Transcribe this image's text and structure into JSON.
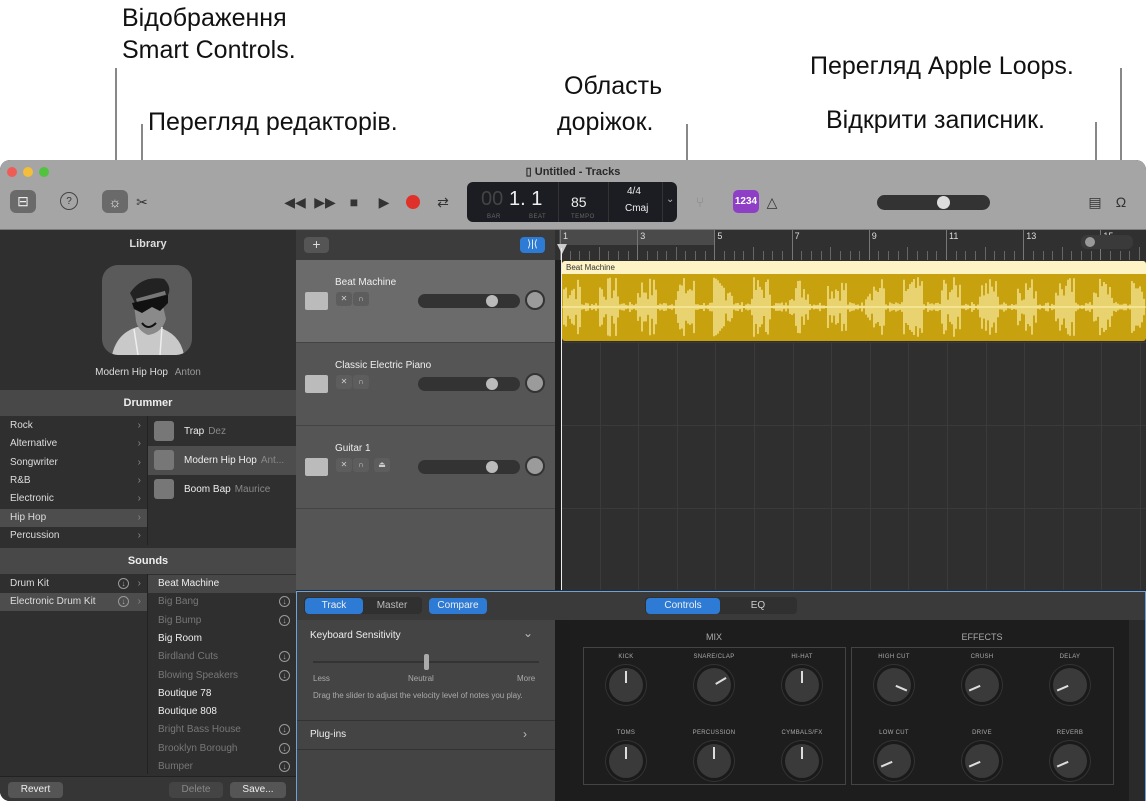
{
  "callouts": {
    "smart_controls_line1": "Відображення",
    "smart_controls_line2": "Smart Controls.",
    "editors": "Перегляд редакторів.",
    "tracks_area_line1": "Область",
    "tracks_area_line2": "доріжок.",
    "apple_loops": "Перегляд Apple Loops.",
    "notepad": "Відкрити записник."
  },
  "window": {
    "title": "Untitled - Tracks"
  },
  "toolbar": {
    "library_icon": "library-icon",
    "help_icon": "help-icon",
    "smart_controls_icon": "smart-controls-icon",
    "editors_icon": "scissors-icon",
    "transport": [
      "rewind-icon",
      "fast-forward-icon",
      "stop-icon",
      "play-icon",
      "record-icon",
      "cycle-icon"
    ],
    "lcd": {
      "bar_dim": "00",
      "position": "1. 1",
      "bar_label": "BAR",
      "beat_label": "BEAT",
      "tempo": "85",
      "tempo_label": "TEMPO",
      "signature": "4/4",
      "key": "Cmaj"
    },
    "count_in": "1234",
    "master_volume": 0.6,
    "record_color": "#e0302a",
    "count_in_color": "#8e3fc6"
  },
  "library": {
    "title": "Library",
    "selected_drummer": "Modern Hip Hop",
    "selected_drummer_name": "Anton",
    "drummer_header": "Drummer",
    "genres": [
      {
        "label": "Rock"
      },
      {
        "label": "Alternative"
      },
      {
        "label": "Songwriter"
      },
      {
        "label": "R&B"
      },
      {
        "label": "Electronic"
      },
      {
        "label": "Hip Hop"
      },
      {
        "label": "Percussion"
      }
    ],
    "drummers": [
      {
        "style": "Trap",
        "name": "Dez"
      },
      {
        "style": "Modern Hip Hop",
        "name": "Ant..."
      },
      {
        "style": "Boom Bap",
        "name": "Maurice"
      }
    ],
    "sounds_header": "Sounds",
    "sound_categories": [
      {
        "label": "Drum Kit"
      },
      {
        "label": "Electronic Drum Kit"
      }
    ],
    "sounds": [
      {
        "label": "Beat Machine"
      },
      {
        "label": "Big Bang"
      },
      {
        "label": "Big Bump"
      },
      {
        "label": "Big Room"
      },
      {
        "label": "Birdland Cuts"
      },
      {
        "label": "Blowing Speakers"
      },
      {
        "label": "Boutique 78"
      },
      {
        "label": "Boutique 808"
      },
      {
        "label": "Bright Bass House"
      },
      {
        "label": "Brooklyn Borough"
      },
      {
        "label": "Bumper"
      }
    ],
    "buttons": {
      "revert": "Revert",
      "delete": "Delete",
      "save": "Save..."
    }
  },
  "tracks": {
    "add_label": "+",
    "items": [
      {
        "name": "Beat Machine",
        "volume": 0.75
      },
      {
        "name": "Classic Electric Piano",
        "volume": 0.75
      },
      {
        "name": "Guitar 1",
        "volume": 0.75
      }
    ],
    "ruler": [
      "1",
      "3",
      "5",
      "7",
      "9",
      "11",
      "13",
      "15"
    ],
    "region_name": "Beat Machine",
    "region_color": "#c8a20e"
  },
  "smart_controls": {
    "tabs": {
      "track": "Track",
      "master": "Master",
      "compare": "Compare"
    },
    "view_tabs": {
      "controls": "Controls",
      "eq": "EQ"
    },
    "keyboard_sensitivity": {
      "title": "Keyboard Sensitivity",
      "less": "Less",
      "neutral": "Neutral",
      "more": "More",
      "value": 0.5,
      "help": "Drag the slider to adjust the velocity level of notes you play."
    },
    "plugins": "Plug-ins",
    "mix": {
      "title": "MIX",
      "knobs": [
        {
          "label": "KICK",
          "value": 0.5
        },
        {
          "label": "SNARE/CLAP",
          "value": 0.72
        },
        {
          "label": "HI-HAT",
          "value": 0.5
        },
        {
          "label": "TOMS",
          "value": 0.5
        },
        {
          "label": "PERCUSSION",
          "value": 0.5
        },
        {
          "label": "CYMBALS/FX",
          "value": 0.5
        }
      ]
    },
    "effects": {
      "title": "EFFECTS",
      "knobs": [
        {
          "label": "HIGH CUT",
          "value": 0.92
        },
        {
          "label": "CRUSH",
          "value": 0.08
        },
        {
          "label": "DELAY",
          "value": 0.08
        },
        {
          "label": "LOW CUT",
          "value": 0.08
        },
        {
          "label": "DRIVE",
          "value": 0.08
        },
        {
          "label": "REVERB",
          "value": 0.08
        }
      ]
    }
  }
}
